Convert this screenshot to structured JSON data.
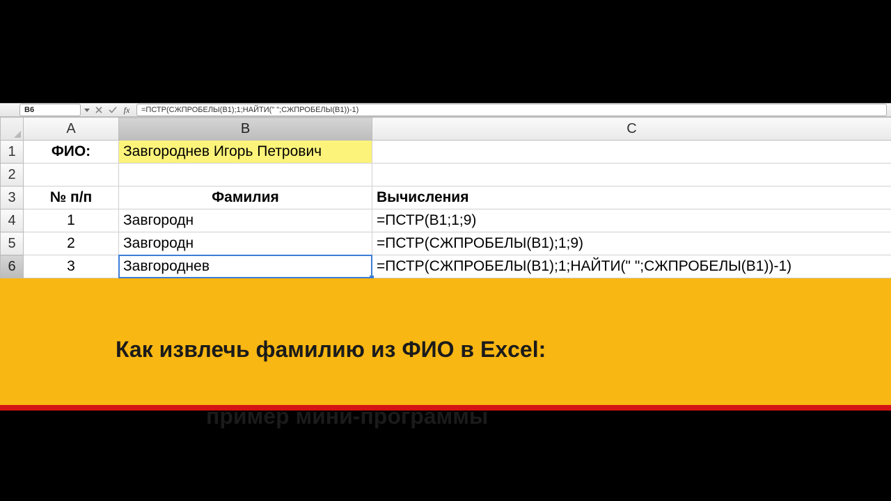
{
  "colors": {
    "highlight": "#fcf47a",
    "banner": "#f8b712",
    "banner_rule": "#d41414",
    "selection": "#3b7dd8"
  },
  "name_box": "B6",
  "fx_label": "fx",
  "formula": "=ПСТР(СЖПРОБЕЛЫ(B1);1;НАЙТИ(\" \";СЖПРОБЕЛЫ(B1))-1)",
  "columns": {
    "A": "A",
    "B": "B",
    "C": "C"
  },
  "row_numbers": [
    "1",
    "2",
    "3",
    "4",
    "5",
    "6"
  ],
  "active_cell": "B6",
  "cells": {
    "A1": "ФИО:",
    "B1": "Завгороднев Игорь Петрович",
    "A3": "№ п/п",
    "B3": "Фамилия",
    "C3": "Вычисления",
    "A4": "1",
    "B4": "Завгородн",
    "C4": "=ПСТР(B1;1;9)",
    "A5": "2",
    "B5": "Завгородн",
    "C5": "=ПСТР(СЖПРОБЕЛЫ(B1);1;9)",
    "A6": "3",
    "B6": "Завгороднев",
    "C6": "=ПСТР(СЖПРОБЕЛЫ(B1);1;НАЙТИ(\" \";СЖПРОБЕЛЫ(B1))-1)"
  },
  "banner": {
    "line1": "Как извлечь фамилию из ФИО в Excel:",
    "line2": "пример мини-программы"
  }
}
